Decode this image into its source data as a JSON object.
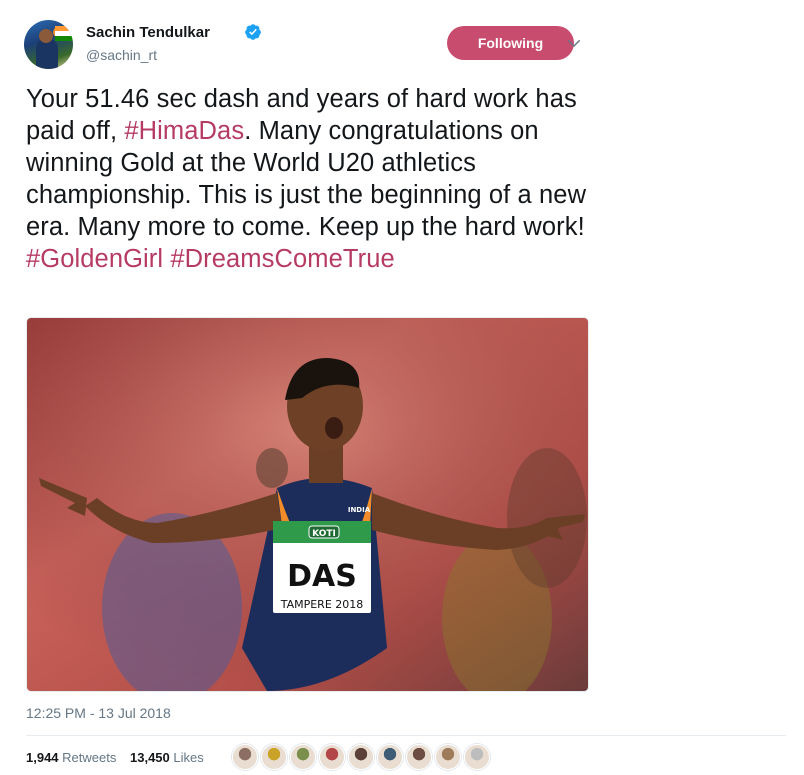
{
  "author": {
    "name": "Sachin Tendulkar",
    "handle": "@sachin_rt",
    "verified": true
  },
  "follow_button": {
    "label": "Following",
    "color": "#c84c6e"
  },
  "tweet": {
    "segments": [
      {
        "text": "Your 51.46 sec dash and years of hard work has paid off, ",
        "hashtag": false
      },
      {
        "text": "#HimaDas",
        "hashtag": true
      },
      {
        "text": ". Many congratulations on winning Gold at the World U20 athletics championship. This is just the beginning of a new era. Many more to come. Keep up the hard work! ",
        "hashtag": false
      },
      {
        "text": "#GoldenGirl",
        "hashtag": true
      },
      {
        "text": " ",
        "hashtag": false
      },
      {
        "text": "#DreamsComeTrue",
        "hashtag": true
      }
    ],
    "hashtag_color": "#b63b63"
  },
  "media": {
    "bib_name": "DAS",
    "bib_sponsor": "KOTI",
    "bib_event": "TAMPERE 2018",
    "kit_text": "INDIA"
  },
  "timestamp": "12:25 PM - 13 Jul 2018",
  "stats": {
    "retweets_count": "1,944",
    "retweets_label": "Retweets",
    "likes_count": "13,450",
    "likes_label": "Likes"
  },
  "likers": [
    {
      "color": "#8d6e63"
    },
    {
      "color": "#c9a227"
    },
    {
      "color": "#7a8f4b"
    },
    {
      "color": "#b34747"
    },
    {
      "color": "#5d4037"
    },
    {
      "color": "#3e5c76"
    },
    {
      "color": "#6d4c41"
    },
    {
      "color": "#9e7b5a"
    },
    {
      "color": "#bdbdbd"
    }
  ]
}
